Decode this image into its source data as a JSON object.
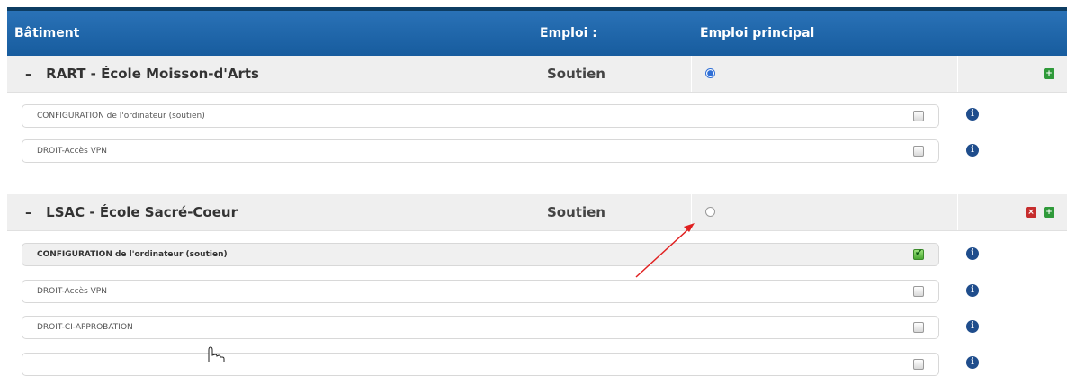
{
  "table_header": {
    "col_building": "Bâtiment",
    "col_job": "Emploi :",
    "col_main_job": "Emploi principal"
  },
  "groups": [
    {
      "collapse_glyph": "–",
      "name": "RART - École Moisson-d'Arts",
      "job": "Soutien",
      "main_job_selected": true,
      "items": [
        {
          "label": "CONFIGURATION de l'ordinateur (soutien)",
          "checked": false
        },
        {
          "label": "DROIT-Accès VPN",
          "checked": false
        }
      ]
    },
    {
      "collapse_glyph": "–",
      "name": "LSAC - École Sacré-Coeur",
      "job": "Soutien",
      "main_job_selected": false,
      "items": [
        {
          "label": "CONFIGURATION de l'ordinateur (soutien)",
          "checked": true
        },
        {
          "label": "DROIT-Accès VPN",
          "checked": false
        },
        {
          "label": "DROIT-CI-APPROBATION",
          "checked": false
        }
      ]
    }
  ],
  "info_glyph": "i",
  "colors": {
    "header_bg": "#1f66ab",
    "radio_selected": "#2f6fd6",
    "add_button": "#2f9a3a",
    "delete_button": "#c62d2d",
    "annotation_arrow": "#e02020"
  },
  "icons": [
    "collapse-icon",
    "radio",
    "add-icon",
    "delete-icon",
    "info-icon",
    "checkbox",
    "hand-cursor-icon",
    "annotation-arrow"
  ]
}
